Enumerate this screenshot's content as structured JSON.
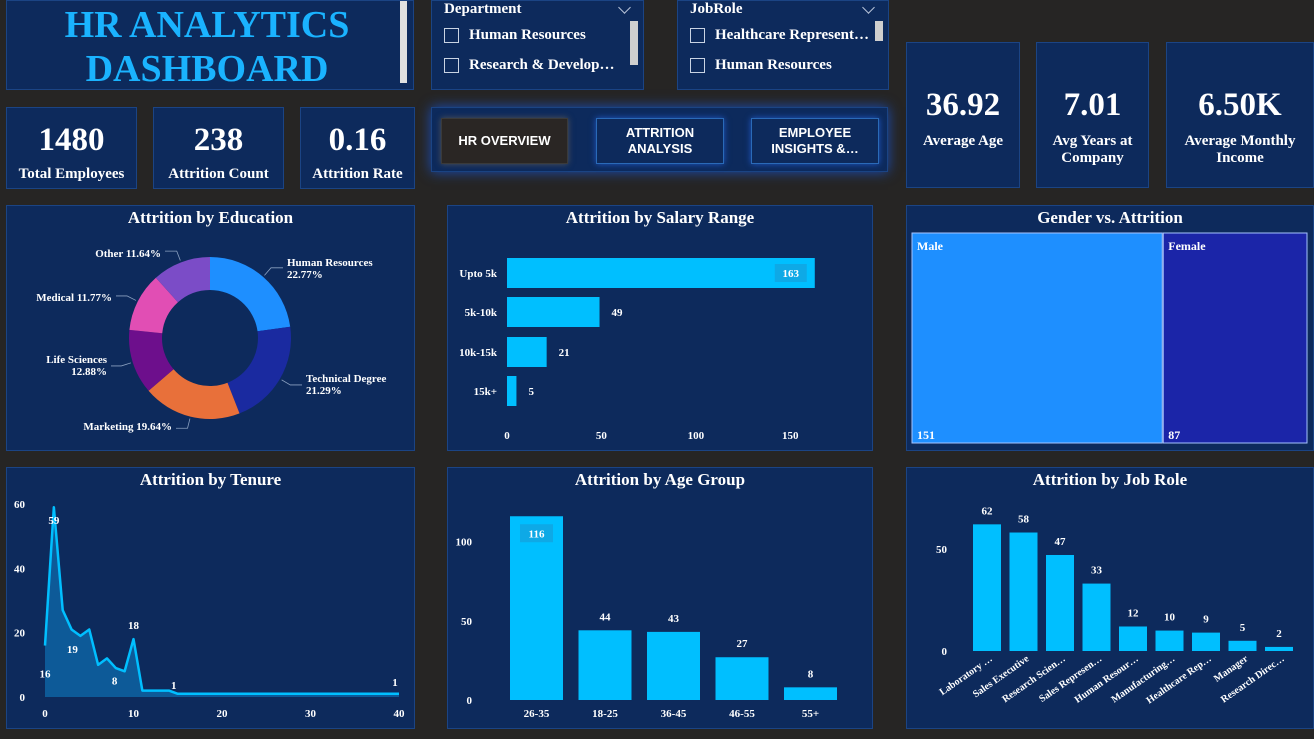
{
  "title": {
    "line1": "HR ANALYTICS",
    "line2": "DASHBOARD"
  },
  "colors": {
    "accent": "#00bfff",
    "panel": "#0d2a5c",
    "background": "#262524",
    "male": "#1e8fff",
    "female": "#1b25a8"
  },
  "department_slicer": {
    "header": "Department",
    "items": [
      "Human Resources",
      "Research & Develop…"
    ]
  },
  "jobrole_slicer": {
    "header": "JobRole",
    "items": [
      "Healthcare Represent…",
      "Human Resources"
    ]
  },
  "kpis_left": [
    {
      "value": "1480",
      "label": "Total Employees"
    },
    {
      "value": "238",
      "label": "Attrition Count"
    },
    {
      "value": "0.16",
      "label": "Attrition Rate"
    }
  ],
  "kpis_right": [
    {
      "value": "36.92",
      "label": "Average Age"
    },
    {
      "value": "7.01",
      "label": "Avg Years at Company"
    },
    {
      "value": "6.50K",
      "label": "Average Monthly Income"
    }
  ],
  "nav": [
    {
      "label": "HR OVERVIEW",
      "active": true
    },
    {
      "label": "ATTRITION ANALYSIS",
      "active": false
    },
    {
      "label": "EMPLOYEE INSIGHTS &…",
      "active": false
    }
  ],
  "chart_data": [
    {
      "id": "education",
      "type": "pie",
      "title": "Attrition by Education",
      "slices": [
        {
          "label": "Human Resources",
          "value": 22.77,
          "display": "22.77%",
          "color": "#1e8fff"
        },
        {
          "label": "Technical Degree",
          "value": 21.29,
          "display": "21.29%",
          "color": "#1a2aa0"
        },
        {
          "label": "Marketing",
          "value": 19.64,
          "display": "19.64%",
          "color": "#e8703a"
        },
        {
          "label": "Life Sciences",
          "value": 12.88,
          "display": "12.88%",
          "color": "#6d0f8c"
        },
        {
          "label": "Medical",
          "value": 11.77,
          "display": "11.77%",
          "color": "#e14eb4"
        },
        {
          "label": "Other",
          "value": 11.64,
          "display": "11.64%",
          "color": "#7b4cc7"
        }
      ]
    },
    {
      "id": "salary",
      "type": "bar",
      "orientation": "horizontal",
      "title": "Attrition by Salary Range",
      "categories": [
        "Upto 5k",
        "5k-10k",
        "10k-15k",
        "15k+"
      ],
      "values": [
        163,
        49,
        21,
        5
      ],
      "xticks": [
        0,
        50,
        100,
        150
      ],
      "xlim": [
        0,
        170
      ]
    },
    {
      "id": "gender",
      "type": "treemap",
      "title": "Gender vs. Attrition",
      "items": [
        {
          "label": "Male",
          "value": 151
        },
        {
          "label": "Female",
          "value": 87
        }
      ]
    },
    {
      "id": "tenure",
      "type": "area",
      "title": "Attrition by Tenure",
      "points": [
        [
          0,
          16
        ],
        [
          1,
          59
        ],
        [
          2,
          27
        ],
        [
          3,
          21
        ],
        [
          4,
          19
        ],
        [
          5,
          21
        ],
        [
          6,
          10
        ],
        [
          7,
          12
        ],
        [
          8,
          9
        ],
        [
          9,
          8
        ],
        [
          10,
          18
        ],
        [
          11,
          2
        ],
        [
          12,
          2
        ],
        [
          13,
          2
        ],
        [
          14,
          2
        ],
        [
          15,
          1
        ],
        [
          20,
          1
        ],
        [
          25,
          1
        ],
        [
          30,
          1
        ],
        [
          35,
          1
        ],
        [
          40,
          1
        ]
      ],
      "labeled": [
        [
          0,
          16
        ],
        [
          1,
          59
        ],
        [
          4,
          19
        ],
        [
          9,
          8
        ],
        [
          10,
          18
        ],
        [
          15,
          1
        ],
        [
          40,
          1
        ]
      ],
      "xticks": [
        0,
        10,
        20,
        30,
        40
      ],
      "yticks": [
        0,
        20,
        40,
        60
      ],
      "xlim": [
        0,
        40
      ],
      "ylim": [
        0,
        60
      ]
    },
    {
      "id": "agegroup",
      "type": "bar",
      "title": "Attrition by Age Group",
      "categories": [
        "26-35",
        "18-25",
        "36-45",
        "46-55",
        "55+"
      ],
      "values": [
        116,
        44,
        43,
        27,
        8
      ],
      "yticks": [
        0,
        50,
        100
      ],
      "ylim": [
        0,
        125
      ]
    },
    {
      "id": "jobrole",
      "type": "bar",
      "title": "Attrition by Job Role",
      "categories": [
        "Laboratory …",
        "Sales Executive",
        "Research Scien…",
        "Sales Represen…",
        "Human Resour…",
        "Manufacturing…",
        "Healthcare Rep…",
        "Manager",
        "Research Direc…"
      ],
      "values": [
        62,
        58,
        47,
        33,
        12,
        10,
        9,
        5,
        2
      ],
      "yticks": [
        0,
        50
      ],
      "ylim": [
        0,
        70
      ]
    }
  ]
}
